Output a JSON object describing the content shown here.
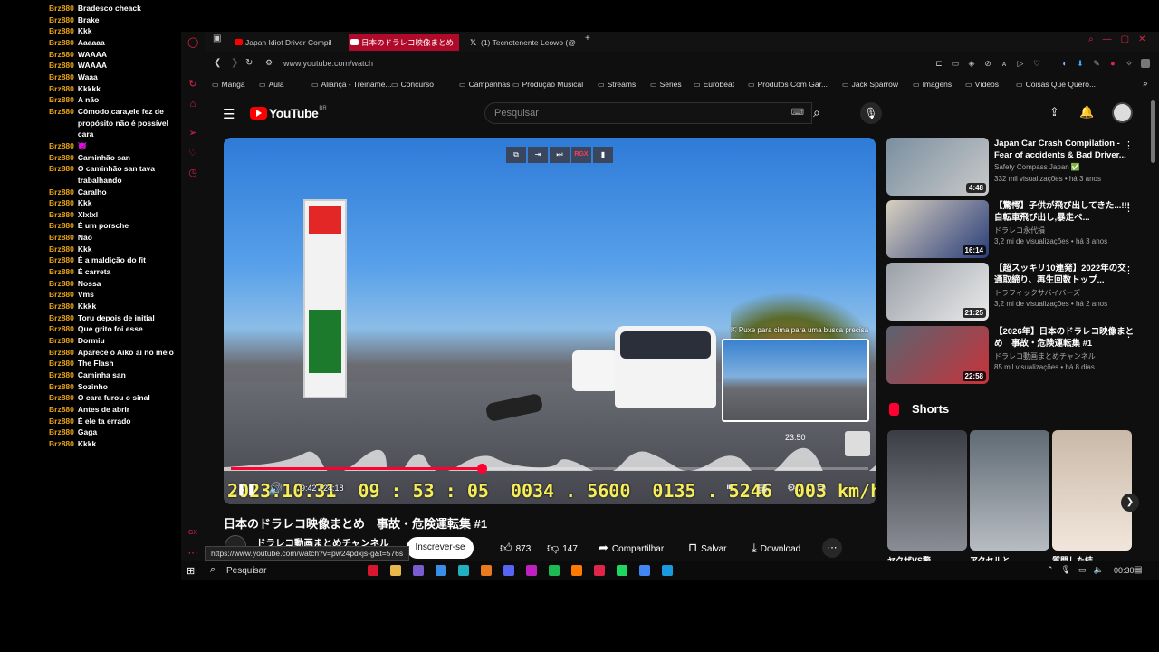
{
  "chat": {
    "messages": [
      {
        "user": "Brz880",
        "text": "Bradesco cheack"
      },
      {
        "user": "Brz880",
        "text": "Brake"
      },
      {
        "user": "Brz880",
        "text": "Kkk"
      },
      {
        "user": "Brz880",
        "text": "Aaaaaa"
      },
      {
        "user": "Brz880",
        "text": "WAAAA"
      },
      {
        "user": "Brz880",
        "text": "WAAAA"
      },
      {
        "user": "Brz880",
        "text": "Waaa"
      },
      {
        "user": "Brz880",
        "text": "Kkkkk"
      },
      {
        "user": "Brz880",
        "text": "A não"
      },
      {
        "user": "Brz880",
        "text": "Cômodo,cara,ele fez de propósito não é possível cara"
      },
      {
        "user": "Brz880",
        "text": "😈"
      },
      {
        "user": "Brz880",
        "text": "Caminhão san"
      },
      {
        "user": "Brz880",
        "text": "O caminhão san tava trabalhando"
      },
      {
        "user": "Brz880",
        "text": "Caralho"
      },
      {
        "user": "Brz880",
        "text": "Kkk"
      },
      {
        "user": "Brz880",
        "text": "Xlxlxl"
      },
      {
        "user": "Brz880",
        "text": "É um porsche"
      },
      {
        "user": "Brz880",
        "text": "Não"
      },
      {
        "user": "Brz880",
        "text": "Kkk"
      },
      {
        "user": "Brz880",
        "text": "É a maldição do fit"
      },
      {
        "user": "Brz880",
        "text": "É carreta"
      },
      {
        "user": "Brz880",
        "text": "Nossa"
      },
      {
        "user": "Brz880",
        "text": "Vms"
      },
      {
        "user": "Brz880",
        "text": "Kkkk"
      },
      {
        "user": "Brz880",
        "text": "Toru depois de initial"
      },
      {
        "user": "Brz880",
        "text": "Que grito foi esse"
      },
      {
        "user": "Brz880",
        "text": "Dormiu"
      },
      {
        "user": "Brz880",
        "text": "Aparece o Aiko ai no meio"
      },
      {
        "user": "Brz880",
        "text": "The Flash"
      },
      {
        "user": "Brz880",
        "text": "Caminha san"
      },
      {
        "user": "Brz880",
        "text": "Sozinho"
      },
      {
        "user": "Brz880",
        "text": "O cara furou o sinal"
      },
      {
        "user": "Brz880",
        "text": "Antes de abrir"
      },
      {
        "user": "Brz880",
        "text": "É ele ta errado"
      },
      {
        "user": "Brz880",
        "text": "Gaga"
      },
      {
        "user": "Brz880",
        "text": "Kkkk"
      }
    ]
  },
  "tabs": [
    {
      "label": "Japan Idiot Driver Compil",
      "icon": "youtube-icon"
    },
    {
      "label": "日本のドラレコ映像まとめ",
      "icon": "youtube-icon"
    },
    {
      "label": "(1) Tecnotenente Leowo (@",
      "icon": "x-icon"
    }
  ],
  "address": {
    "url": "www.youtube.com/watch"
  },
  "bookmarks": [
    "Mangá",
    "Aula",
    "Aliança - Treiname...",
    "Concurso",
    "Campanhas",
    "Produção Musical",
    "Streams",
    "Séries",
    "Eurobeat",
    "Produtos Com Gar...",
    "Jack Sparrow",
    "Imagens",
    "Vídeos",
    "Coisas Que Quero..."
  ],
  "youtube": {
    "logo_text": "YouTube",
    "country_code": "BR",
    "search_placeholder": "Pesquisar"
  },
  "player": {
    "top_controls": [
      "⧉",
      "⇥",
      "⏭",
      "RGX",
      "▮"
    ],
    "preview_hint": "⇱ Puxe para cima para uma busca precisa",
    "preview_time": "23:50",
    "progress": 0.393,
    "time_display": "9:42 / 24:18",
    "dash_overlay": [
      "2023.10.31",
      "09 : 53 : 05",
      "0034 . 5600",
      "0135 . 5246",
      "003 km/h"
    ]
  },
  "video": {
    "title": "日本のドラレコ映像まとめ　事故・危険運転集 #1",
    "channel": "ドラレコ動画まとめチャンネル",
    "subscribe_label": "Inscrever-se",
    "likes": "873",
    "dislikes": "147",
    "share_label": "Compartilhar",
    "save_label": "Salvar",
    "download_label": "Download"
  },
  "status_url": "https://www.youtube.com/watch?v=pw24pdxjs-g&t=576s",
  "recommendations": [
    {
      "title": "Japan Car Crash Compilation - Fear of accidents & Bad Driver...",
      "channel": "Safety Compass Japan ✅",
      "meta": "332 mil visualizações • há 3 anos",
      "duration": "4:48",
      "colors": [
        "#7a8fa0",
        "#c9c9c9"
      ]
    },
    {
      "title": "【驚愕】子供が飛び出してきた...!!! 自転車飛び出し,暴走ベ...",
      "channel": "ドラレコ永代損",
      "meta": "3,2 mi de visualizações • há 3 anos",
      "duration": "16:14",
      "colors": [
        "#d8d0c0",
        "#2a3d7a"
      ]
    },
    {
      "title": "【超スッキリ10連発】2022年の交通取締り、再生回数トップ...",
      "channel": "トラフィックサバイバーズ",
      "meta": "3,2 mi de visualizações • há 2 anos",
      "duration": "21:25",
      "colors": [
        "#9aa0a8",
        "#eaeaea"
      ]
    },
    {
      "title": "【2026年】日本のドラレコ映像まとめ　事故・危険運転集 #1",
      "channel": "ドラレコ動画まとめチャンネル",
      "meta": "85 mil visualizações • há 8 dias",
      "duration": "22:58",
      "colors": [
        "#5a6470",
        "#c8323a"
      ]
    }
  ],
  "shorts": {
    "title": "Shorts",
    "items": [
      {
        "label": "ヤクザVS警",
        "colors": [
          "#3a3d44",
          "#8a8d95"
        ]
      },
      {
        "label": "アクセルと",
        "colors": [
          "#5f6a73",
          "#b7bcc2"
        ]
      },
      {
        "label": "質問した結",
        "colors": [
          "#c9b9a8",
          "#f2e6dc"
        ]
      }
    ]
  },
  "taskbar": {
    "search_label": "Pesquisar",
    "clock": "00:30",
    "apps": [
      "#d8162e",
      "#e8b84a",
      "#7a5bd0",
      "#3a8ee6",
      "#20b0c0",
      "#e87a20",
      "#5865f2",
      "#c020c0",
      "#1db954",
      "#ff7a00",
      "#e0244a",
      "#1ed760",
      "#4285f4",
      "#1b9ae0"
    ]
  }
}
